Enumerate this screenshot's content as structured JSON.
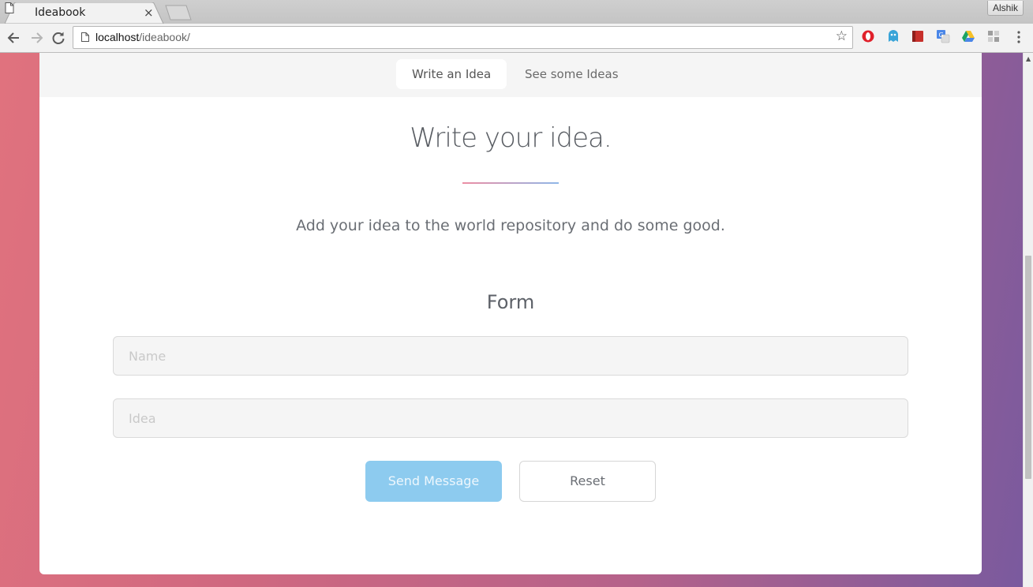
{
  "browser": {
    "tab_title": "Ideabook",
    "tab_close": "×",
    "profile_name": "Alshik",
    "url_host": "localhost",
    "url_path": "/ideabook/",
    "bookmark_star": "☆",
    "extension_badge": "0",
    "icons": [
      "back-arrow-icon",
      "forward-arrow-icon",
      "reload-icon",
      "page-icon",
      "star-icon",
      "opera-icon",
      "ghostery-icon",
      "bookmark-ext-icon",
      "translate-icon",
      "drive-icon",
      "puzzle-icon",
      "menu-dots-icon"
    ]
  },
  "nav": {
    "items": [
      {
        "label": "Write an Idea",
        "active": true
      },
      {
        "label": "See some Ideas",
        "active": false
      }
    ]
  },
  "main": {
    "title": "Write your idea.",
    "subtitle": "Add your idea to the world repository and do some good.",
    "form_title": "Form",
    "name_placeholder": "Name",
    "idea_placeholder": "Idea",
    "send_label": "Send Message",
    "reset_label": "Reset"
  },
  "colors": {
    "send_button": "#8dcbef",
    "divider_start": "#ec8ea4",
    "divider_end": "#8fb7e8",
    "background_left": "#e0727e",
    "background_right": "#7a5a9e"
  }
}
